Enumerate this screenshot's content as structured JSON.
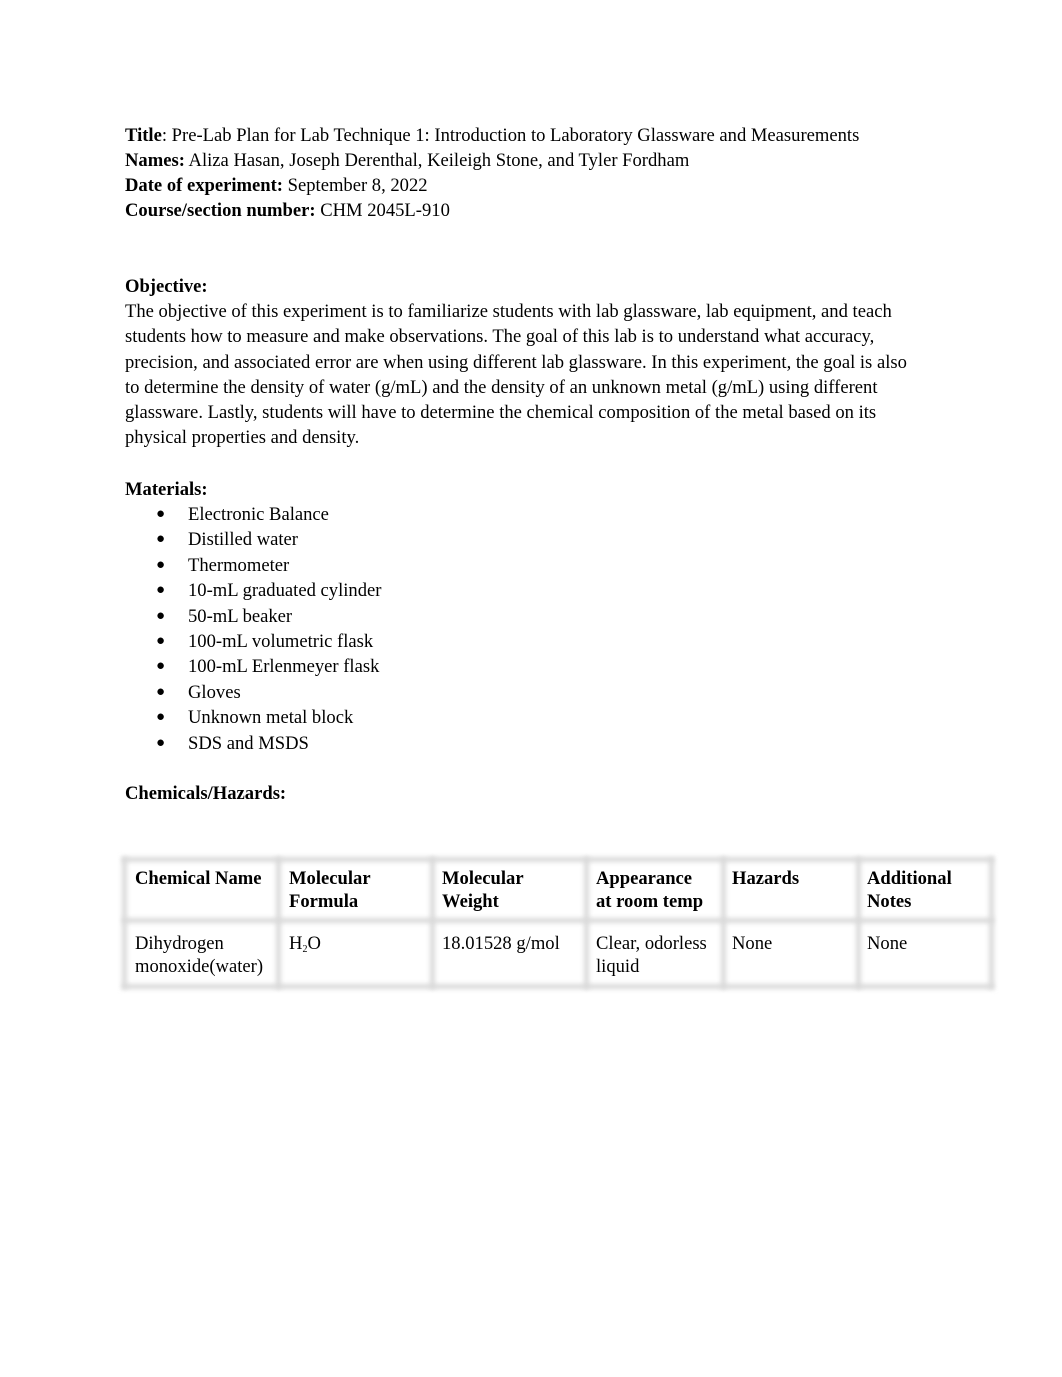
{
  "header": {
    "title_label": "Title",
    "title_value": ": Pre-Lab Plan for Lab Technique 1: Introduction to Laboratory Glassware and Measurements",
    "names_label": "Names:",
    "names_value": " Aliza Hasan, Joseph Derenthal, Keileigh Stone, and Tyler Fordham",
    "date_label": "Date of experiment:",
    "date_value": " September 8, 2022",
    "course_label": "Course/section number:",
    "course_value": " CHM 2045L-910"
  },
  "objective": {
    "heading": "Objective:",
    "lines": [
      "The objective of this experiment is to familiarize students with lab glassware, lab equipment, and teach",
      "students how to measure and make observations. The goal of this lab is to understand what accuracy,",
      "precision, and associated error are when using different lab glassware. In this experiment, the goal is also",
      "to determine the density of water (g/mL) and the density of an unknown metal (g/mL) using different",
      "glassware. Lastly, students will have to determine the chemical composition of the metal based on its",
      "physical properties and density."
    ]
  },
  "materials": {
    "heading": "Materials:",
    "bullet": "●",
    "items": [
      "Electronic Balance",
      "Distilled water",
      "Thermometer",
      "10-mL graduated cylinder",
      "50-mL beaker",
      "100-mL volumetric flask",
      "100-mL Erlenmeyer flask",
      "Gloves",
      "Unknown metal block",
      "SDS and MSDS"
    ]
  },
  "chemicals": {
    "heading": "Chemicals/Hazards:",
    "table": {
      "headers": [
        [
          "Chemical Name",
          ""
        ],
        [
          "Molecular",
          "Formula"
        ],
        [
          "Molecular",
          "Weight"
        ],
        [
          "Appearance",
          "at room temp"
        ],
        [
          "Hazards",
          ""
        ],
        [
          "Additional",
          "Notes"
        ]
      ],
      "rows": [
        {
          "chemical_name": [
            "Dihydrogen",
            "monoxide(water)"
          ],
          "formula_main": "H",
          "formula_sub": "2",
          "formula_end": "O",
          "weight": "18.01528 g/mol",
          "appearance": [
            "Clear, odorless",
            "liquid"
          ],
          "hazards": "None",
          "notes": "None"
        }
      ]
    }
  }
}
